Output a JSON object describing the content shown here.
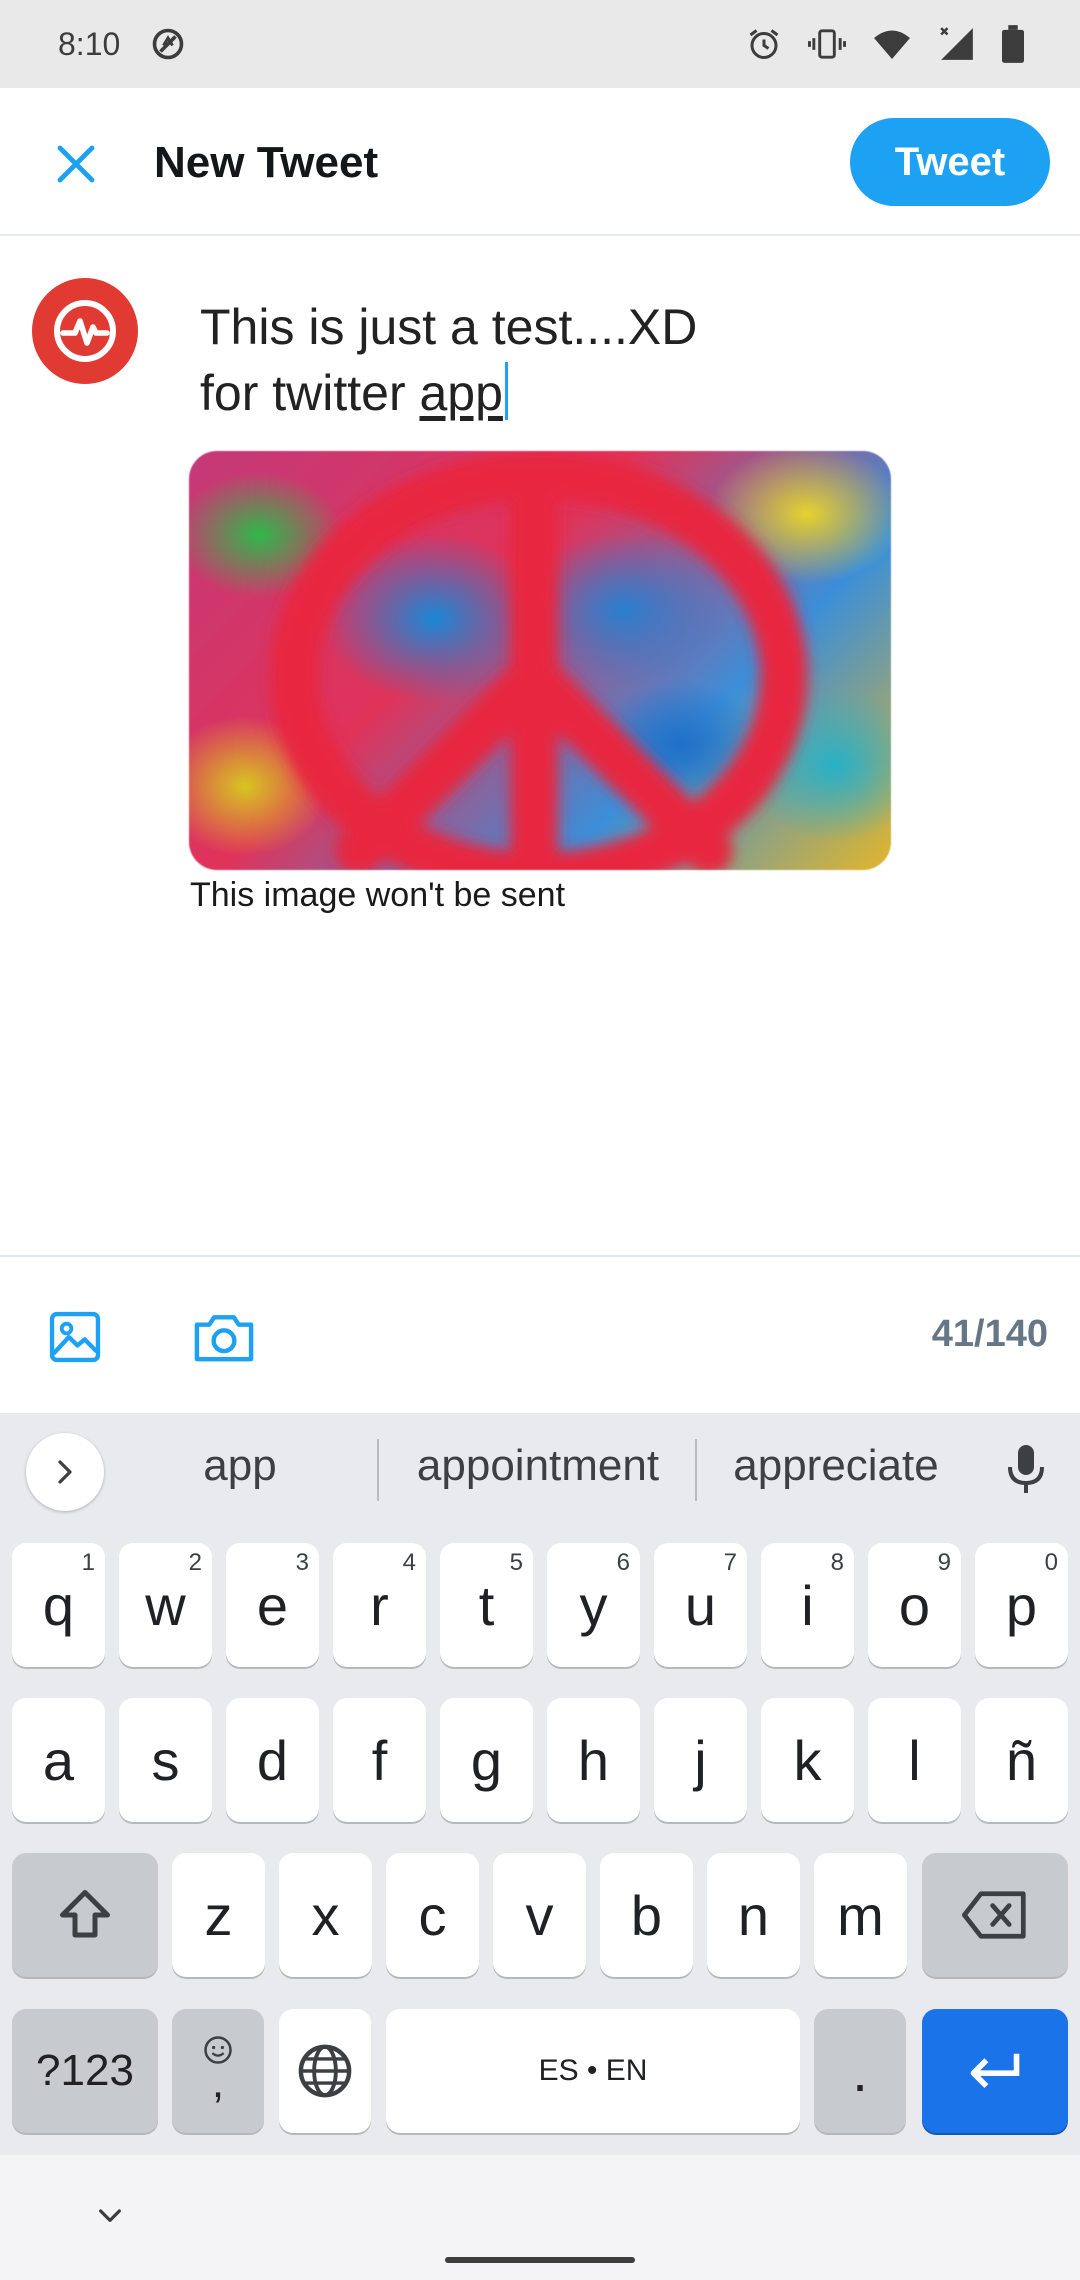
{
  "status_bar": {
    "time": "8:10",
    "icons": [
      "no-sim-data-icon",
      "alarm-icon",
      "vibrate-icon",
      "wifi-icon",
      "signal-icon",
      "battery-icon"
    ]
  },
  "header": {
    "title": "New Tweet",
    "tweet_button": "Tweet",
    "accent_color": "#1da1f2"
  },
  "compose": {
    "line1": "This is just a test....XD",
    "line2_prefix": "for twitter ",
    "line2_composing": "app",
    "media_caption": "This image won't be sent"
  },
  "toolbar": {
    "icons": [
      "gallery-icon",
      "camera-icon"
    ],
    "char_count": "41/140"
  },
  "keyboard": {
    "suggestions": [
      "app",
      "appointment",
      "appreciate"
    ],
    "row1": [
      {
        "k": "q",
        "h": "1"
      },
      {
        "k": "w",
        "h": "2"
      },
      {
        "k": "e",
        "h": "3"
      },
      {
        "k": "r",
        "h": "4"
      },
      {
        "k": "t",
        "h": "5"
      },
      {
        "k": "y",
        "h": "6"
      },
      {
        "k": "u",
        "h": "7"
      },
      {
        "k": "i",
        "h": "8"
      },
      {
        "k": "o",
        "h": "9"
      },
      {
        "k": "p",
        "h": "0"
      }
    ],
    "row2": [
      "a",
      "s",
      "d",
      "f",
      "g",
      "h",
      "j",
      "k",
      "l",
      "ñ"
    ],
    "row3": [
      "z",
      "x",
      "c",
      "v",
      "b",
      "n",
      "m"
    ],
    "symbols_key": "?123",
    "emoji_comma": ",",
    "space_label": "ES • EN",
    "period_key": "."
  }
}
